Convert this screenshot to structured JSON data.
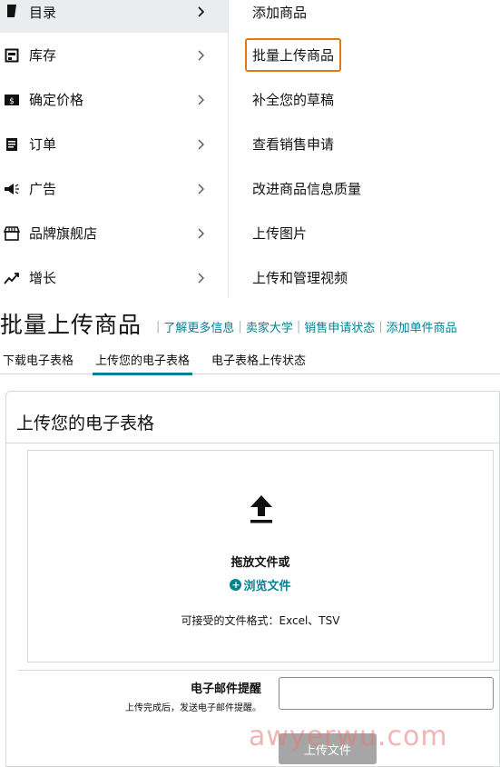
{
  "menu": {
    "left_items": [
      {
        "label": "目录",
        "icon": "catalog-icon"
      },
      {
        "label": "库存",
        "icon": "inventory-icon"
      },
      {
        "label": "确定价格",
        "icon": "pricing-icon"
      },
      {
        "label": "订单",
        "icon": "orders-icon"
      },
      {
        "label": "广告",
        "icon": "megaphone-icon"
      },
      {
        "label": "品牌旗舰店",
        "icon": "store-icon"
      },
      {
        "label": "增长",
        "icon": "growth-icon"
      }
    ],
    "right_items": [
      {
        "label": "添加商品"
      },
      {
        "label": "批量上传商品"
      },
      {
        "label": "补全您的草稿"
      },
      {
        "label": "查看销售申请"
      },
      {
        "label": "改进商品信息质量"
      },
      {
        "label": "上传图片"
      },
      {
        "label": "上传和管理视频"
      }
    ]
  },
  "page": {
    "title": "批量上传商品",
    "links": [
      "了解更多信息",
      "卖家大学",
      "销售申请状态",
      "添加单件商品"
    ],
    "tabs": [
      "下载电子表格",
      "上传您的电子表格",
      "电子表格上传状态"
    ]
  },
  "upload": {
    "card_title": "上传您的电子表格",
    "drag_text": "拖放文件或",
    "browse_text": "浏览文件",
    "formats_text": "可接受的文件格式：Excel、TSV",
    "email_label": "电子邮件提醒",
    "email_hint": "上传完成后，发送电子邮件提醒。",
    "email_value": "",
    "upload_button": "上传文件"
  },
  "watermark": "awyerwu.com",
  "colors": {
    "highlight_border": "#e47911",
    "link": "#008296",
    "active_menu_bg": "#eaeded"
  }
}
